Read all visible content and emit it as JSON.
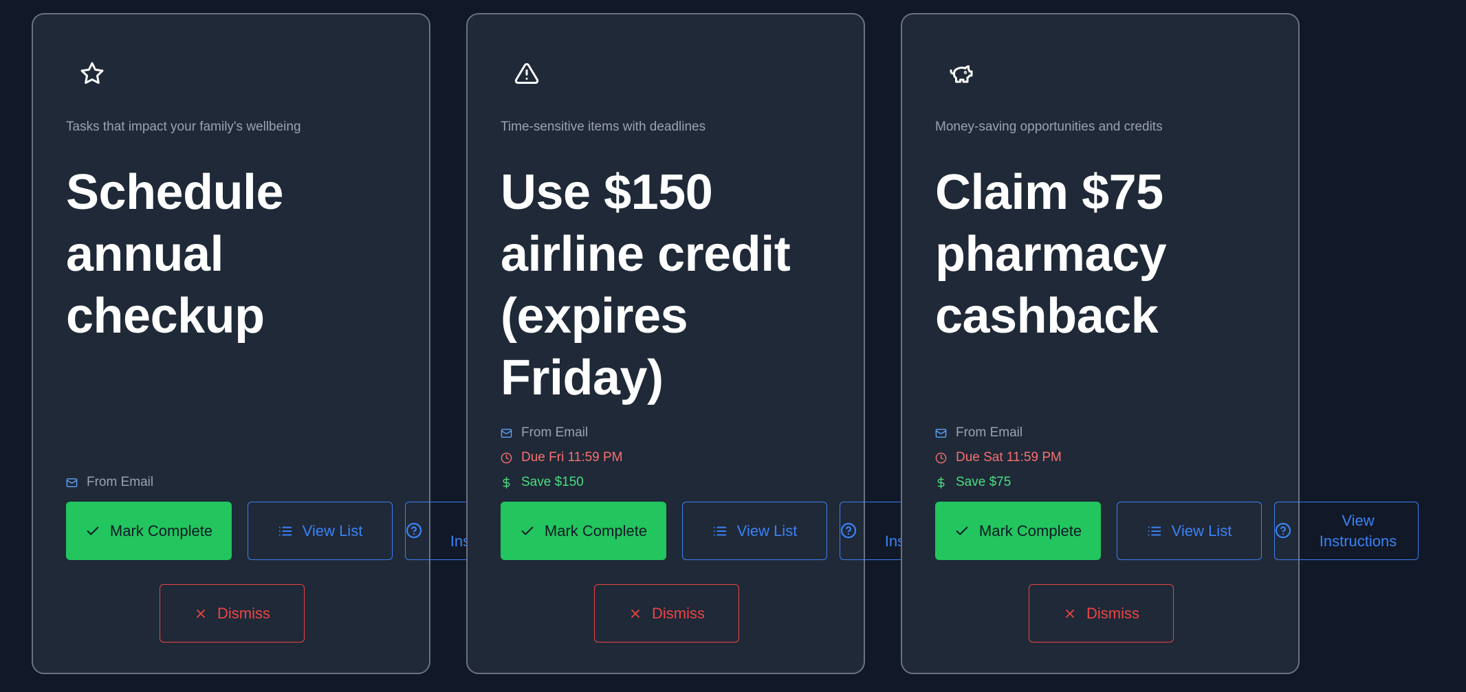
{
  "cards": [
    {
      "icon": "star-icon",
      "subtitle": "Tasks that impact your family's wellbeing",
      "title": "Schedule annual checkup",
      "source": "From Email",
      "due": "",
      "savings": "",
      "buttons": {
        "complete": "Mark Complete",
        "list": "View List",
        "instructions": "View Instructions",
        "dismiss": "Dismiss"
      }
    },
    {
      "icon": "alert-triangle-icon",
      "subtitle": "Time-sensitive items with deadlines",
      "title": "Use $150 airline credit (expires Friday)",
      "source": "From Email",
      "due": "Due Fri 11:59 PM",
      "savings": "Save $150",
      "buttons": {
        "complete": "Mark Complete",
        "list": "View List",
        "instructions": "View Instructions",
        "dismiss": "Dismiss"
      }
    },
    {
      "icon": "piggy-bank-icon",
      "subtitle": "Money-saving opportunities and credits",
      "title": "Claim $75 pharmacy cashback",
      "source": "From Email",
      "due": "Due Sat 11:59 PM",
      "savings": "Save $75",
      "buttons": {
        "complete": "Mark Complete",
        "list": "View List",
        "instructions": "View Instructions",
        "dismiss": "Dismiss"
      }
    }
  ],
  "colors": {
    "background": "#111827",
    "card": "#1f2937",
    "primary": "#3b82f6",
    "success": "#22c55e",
    "danger": "#ef4444"
  }
}
